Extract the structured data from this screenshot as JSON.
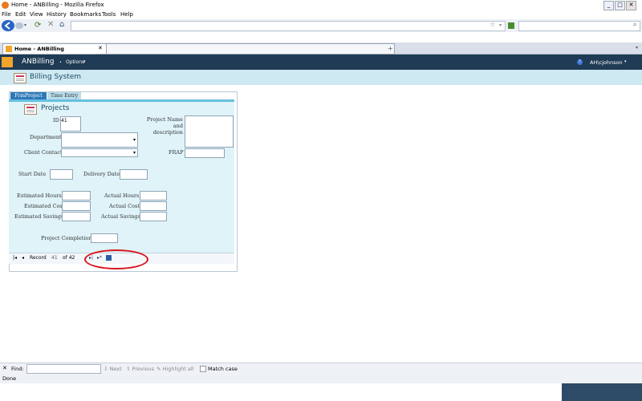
{
  "window": {
    "title": "Home - ANBilling - Mozilla Firefox",
    "min": "_",
    "max": "□",
    "close": "✕"
  },
  "menu": [
    "File",
    "Edit",
    "View",
    "History",
    "Bookmarks",
    "Tools",
    "Help"
  ],
  "tabs": [
    {
      "label": "Home - ANBilling"
    },
    {
      "label": ""
    }
  ],
  "app": {
    "name": "ANBilling",
    "options": "Options",
    "user": "AH\\cjohnson",
    "section": "Billing System"
  },
  "form": {
    "tabs": [
      "FrmProject",
      "Time Entry"
    ],
    "title": "Projects",
    "labels": {
      "id": "ID",
      "project_name": "Project Name and description",
      "department": "Department",
      "client_contact": "Client Contact",
      "frap": "FRAP",
      "start_date": "Start Date",
      "delivery_date": "Delivery Date",
      "estimated_hours": "Estimated Hours",
      "actual_hours": "Actual Hours",
      "estimated_cost": "Estimated Cost",
      "actual_cost": "Actual Cost",
      "estimated_savings": "Estimated Savings",
      "actual_savings": "Actual Savings",
      "project_completion": "Project Completion"
    },
    "values": {
      "id": "41"
    },
    "record_nav": {
      "label": "Record",
      "current": "41",
      "of": "of 42"
    }
  },
  "findbar": {
    "close": "✕",
    "label": "Find:",
    "next": "Next",
    "previous": "Previous",
    "highlight": "Highlight all",
    "match_case": "Match case"
  },
  "status": "Done",
  "colors": {
    "app_header": "#1f3b55",
    "accent": "#66c0dd",
    "annotation": "#d9141b"
  }
}
